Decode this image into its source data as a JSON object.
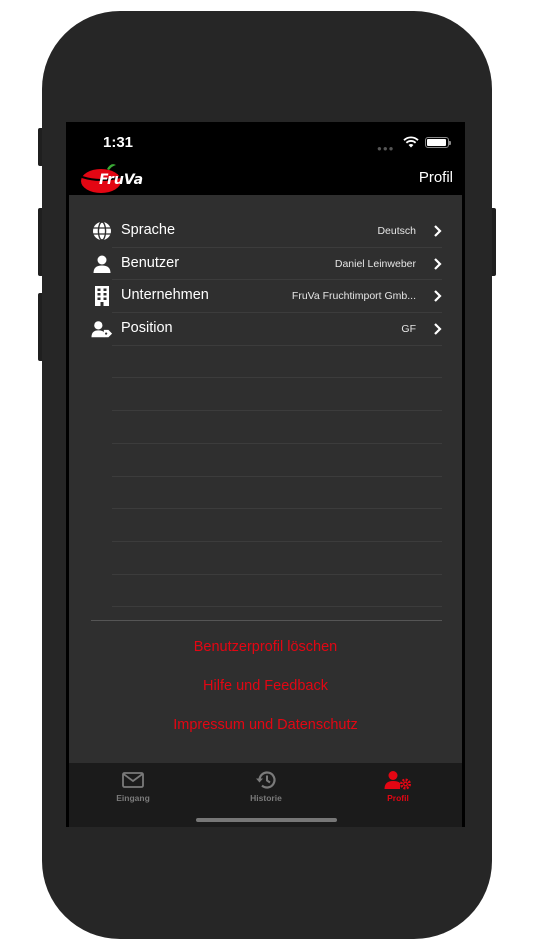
{
  "status_bar": {
    "time": "1:31"
  },
  "navbar": {
    "title": "Profil",
    "logo_text": "FruVa"
  },
  "settings": [
    {
      "label": "Sprache",
      "value": "Deutsch",
      "icon": "globe-icon"
    },
    {
      "label": "Benutzer",
      "value": "Daniel Leinweber",
      "icon": "user-icon"
    },
    {
      "label": "Unternehmen",
      "value": "FruVa Fruchtimport Gmb...",
      "icon": "building-icon"
    },
    {
      "label": "Position",
      "value": "GF",
      "icon": "user-tag-icon"
    }
  ],
  "links": {
    "delete_profile": "Benutzerprofil löschen",
    "help": "Hilfe und Feedback",
    "imprint": "Impressum und Datenschutz"
  },
  "tabs": [
    {
      "label": "Eingang",
      "icon": "envelope-icon"
    },
    {
      "label": "Historie",
      "icon": "history-icon"
    },
    {
      "label": "Profil",
      "icon": "user-cog-icon",
      "active": true
    }
  ],
  "colors": {
    "accent": "#e30613",
    "background": "#2f2f2f",
    "tabbar": "#1b1b1b"
  }
}
